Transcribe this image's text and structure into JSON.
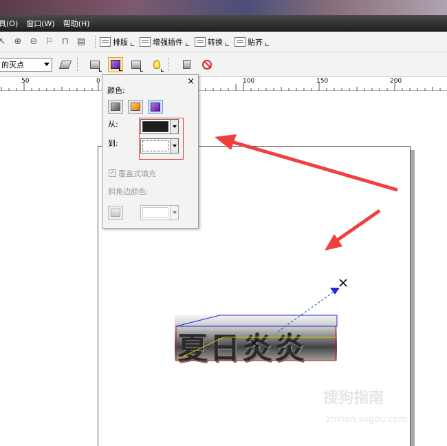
{
  "menubar": {
    "items": [
      "具(O)",
      "窗口(W)",
      "帮助(H)"
    ]
  },
  "toolbar1": {
    "buttons": [
      {
        "label": "排版"
      },
      {
        "label": "增强插件"
      },
      {
        "label": "转换"
      },
      {
        "label": "贴齐"
      }
    ]
  },
  "propertybar": {
    "vanishing_point_value": "的灭点"
  },
  "ruler": {
    "labels": [
      "50",
      "0",
      "100",
      "150",
      "200"
    ]
  },
  "docker": {
    "close_label": "×",
    "color_label": "颜色:",
    "from_label": "从:",
    "to_label": "到:",
    "from_color": "#1e1e1e",
    "to_color": "#ffffff",
    "overlay_fill_label": "覆盖式填充",
    "bevel_color_label": "斜角边颜色:"
  },
  "canvas": {
    "extrude_text": "夏日炎炎"
  },
  "watermark": {
    "text": "搜狗指南",
    "url": "zhinan.sogou.com"
  },
  "colors": {
    "annotation_red": "#ef3f3f",
    "vanish_blue": "#1f2fd6"
  }
}
